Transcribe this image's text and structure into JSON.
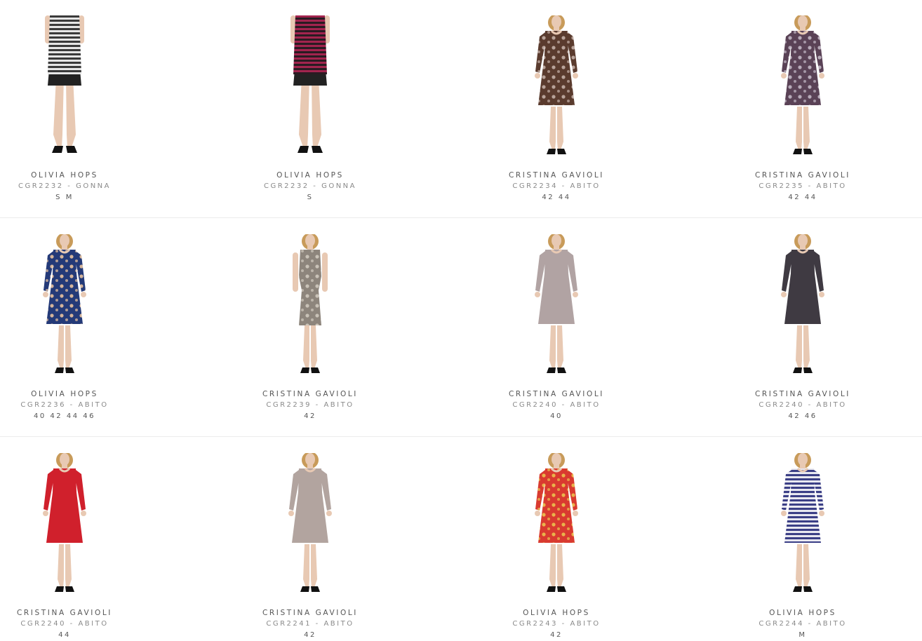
{
  "products": [
    {
      "brand": "OLIVIA HOPS",
      "code": "CGR2232 - GONNA",
      "sizes": "S M",
      "color": "#3a3a3a",
      "accent": "#e6e6e6",
      "pattern": "stripes",
      "garment": "skirt"
    },
    {
      "brand": "OLIVIA HOPS",
      "code": "CGR2232 - GONNA",
      "sizes": "S",
      "color": "#a2244e",
      "accent": "#2a1b22",
      "pattern": "stripes",
      "garment": "skirt"
    },
    {
      "brand": "CRISTINA GAVIOLI",
      "code": "CGR2234 - ABITO",
      "sizes": "42 44",
      "color": "#5a3b2e",
      "accent": "#b8a39a",
      "pattern": "print",
      "garment": "dress-longsleeve"
    },
    {
      "brand": "CRISTINA GAVIOLI",
      "code": "CGR2235 - ABITO",
      "sizes": "42 44",
      "color": "#5a4256",
      "accent": "#b7abb9",
      "pattern": "print",
      "garment": "dress-longsleeve"
    },
    {
      "brand": "OLIVIA HOPS",
      "code": "CGR2236 - ABITO",
      "sizes": "40 42 44 46",
      "color": "#243a78",
      "accent": "#d4b49a",
      "pattern": "print",
      "garment": "dress-longsleeve"
    },
    {
      "brand": "CRISTINA GAVIOLI",
      "code": "CGR2239 - ABITO",
      "sizes": "42",
      "color": "#8d857c",
      "accent": "#c9c2b7",
      "pattern": "print",
      "garment": "dress-sleeveless"
    },
    {
      "brand": "CRISTINA GAVIOLI",
      "code": "CGR2240 - ABITO",
      "sizes": "40",
      "color": "#b1a3a3",
      "accent": "#b1a3a3",
      "pattern": "solid",
      "garment": "dress-longsleeve"
    },
    {
      "brand": "CRISTINA GAVIOLI",
      "code": "CGR2240 - ABITO",
      "sizes": "42 46",
      "color": "#3f3a42",
      "accent": "#3f3a42",
      "pattern": "solid",
      "garment": "dress-longsleeve"
    },
    {
      "brand": "CRISTINA GAVIOLI",
      "code": "CGR2240 - ABITO",
      "sizes": "44",
      "color": "#d0202c",
      "accent": "#d0202c",
      "pattern": "solid",
      "garment": "dress-longsleeve"
    },
    {
      "brand": "CRISTINA GAVIOLI",
      "code": "CGR2241 - ABITO",
      "sizes": "42",
      "color": "#b2a49f",
      "accent": "#9c8f8a",
      "pattern": "solid",
      "garment": "dress-longsleeve"
    },
    {
      "brand": "OLIVIA HOPS",
      "code": "CGR2243 - ABITO",
      "sizes": "42",
      "color": "#d93a30",
      "accent": "#e9b44a",
      "pattern": "print",
      "garment": "dress-longsleeve"
    },
    {
      "brand": "OLIVIA HOPS",
      "code": "CGR2244 - ABITO",
      "sizes": "M",
      "color": "#3b3f86",
      "accent": "#e8e8f0",
      "pattern": "stripes",
      "garment": "dress-longsleeve"
    }
  ]
}
